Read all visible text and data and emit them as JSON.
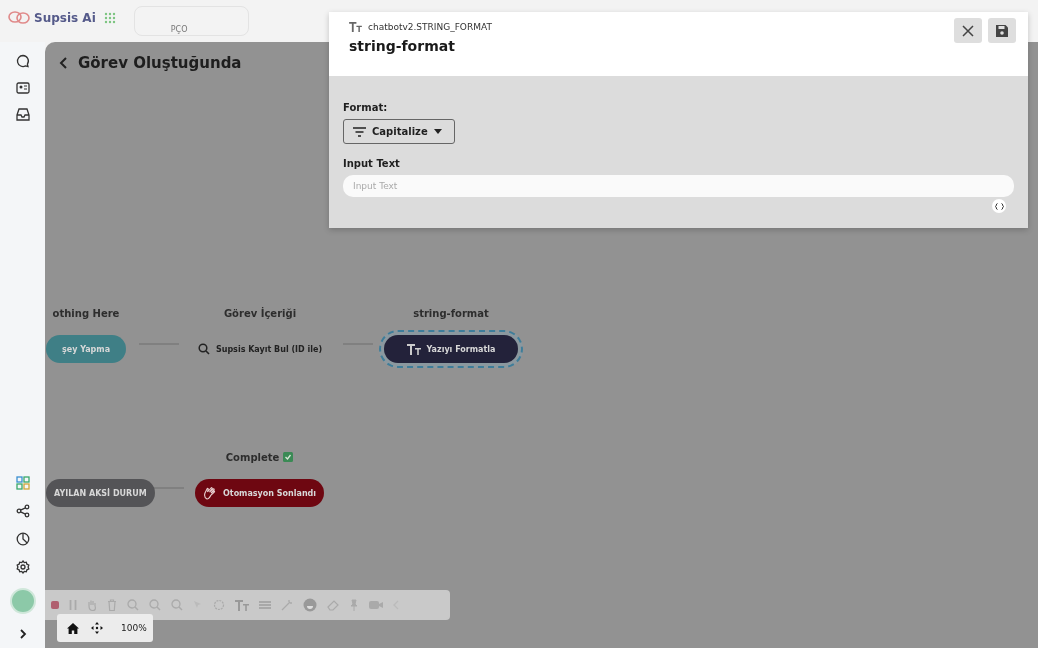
{
  "topbar": {
    "brand": "Supsis Ai",
    "tab_label": "PÇO"
  },
  "canvas": {
    "title": "Görev Oluştuğunda",
    "nodes": [
      {
        "kind": "pill",
        "heading": "othing Here",
        "label": "şey Yapma",
        "color": "#3f7f86",
        "selected": false
      },
      {
        "kind": "search",
        "heading": "Görev İçeriği",
        "label": "Supsis Kayıt Bul (ID ile)",
        "selected": false
      },
      {
        "kind": "text-format",
        "heading": "string-format",
        "label": "Yazıyı Formatla",
        "color": "#23223a",
        "selected": true
      },
      {
        "kind": "pill",
        "label": "AYILAN AKSİ DURUM",
        "color": "#545457",
        "selected": false
      },
      {
        "kind": "end",
        "heading": "Complete",
        "label": "Otomasyon Sonlandı",
        "color": "#6e0711",
        "selected": false
      }
    ],
    "zoom": "100%"
  },
  "panel": {
    "type": "chatbotv2.STRING_FORMAT",
    "title": "string-format",
    "format_label": "Format:",
    "format_value": "Capitalize",
    "input_label": "Input Text",
    "input_placeholder": "Input Text"
  }
}
